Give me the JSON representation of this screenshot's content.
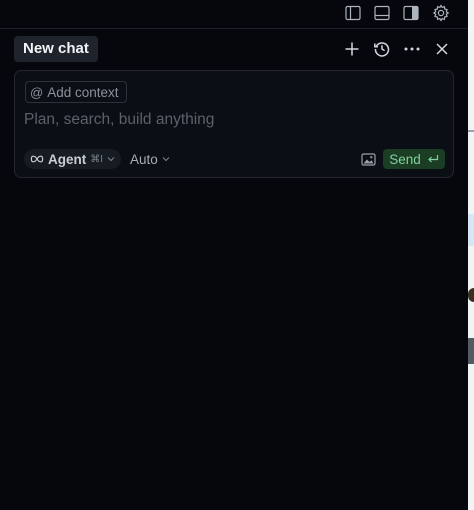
{
  "toolbar": {
    "icons": [
      "sidebar-left-icon",
      "panel-bottom-icon",
      "sidebar-right-icon",
      "gear-icon"
    ]
  },
  "header": {
    "tab_label": "New chat",
    "icons": [
      "plus-icon",
      "history-icon",
      "more-icon",
      "close-icon"
    ]
  },
  "composer": {
    "add_context_label": "Add context",
    "placeholder": "Plan, search, build anything",
    "value": "",
    "mode_label": "Agent",
    "mode_shortcut": "⌘I",
    "model_label": "Auto",
    "send_label": "Send"
  },
  "colors": {
    "background": "#05070d",
    "composer_bg": "#0b0e14",
    "tab_bg": "#1f242c",
    "send_bg": "#1b3d24",
    "send_text": "#7fd39a"
  }
}
